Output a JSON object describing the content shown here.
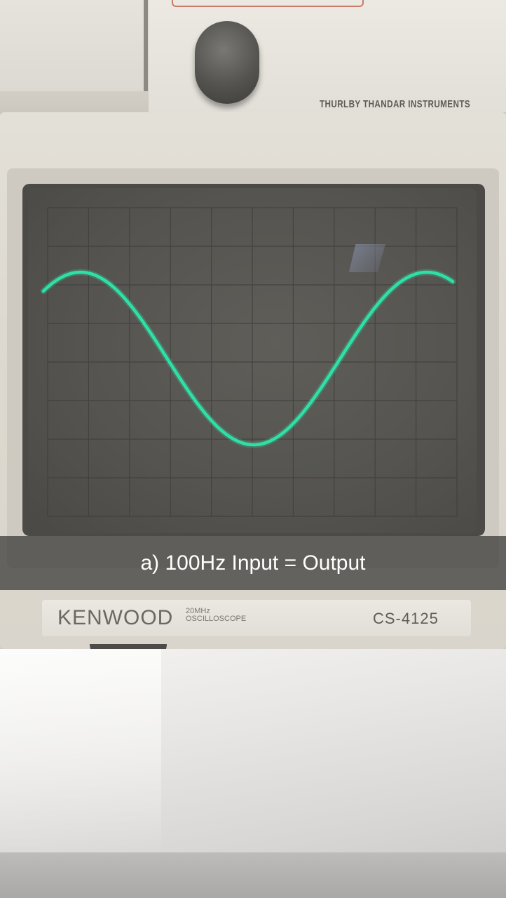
{
  "caption": {
    "text": "a) 100Hz Input = Output"
  },
  "upper_instrument": {
    "brand": "THURLBY THANDAR INSTRUMENTS"
  },
  "oscilloscope": {
    "brand": "KENWOOD",
    "spec_line1": "20MHz",
    "spec_line2": "OSCILLOSCOPE",
    "model": "CS-4125",
    "trace_color": "#2fe0a6",
    "screen_color": "#555450"
  }
}
